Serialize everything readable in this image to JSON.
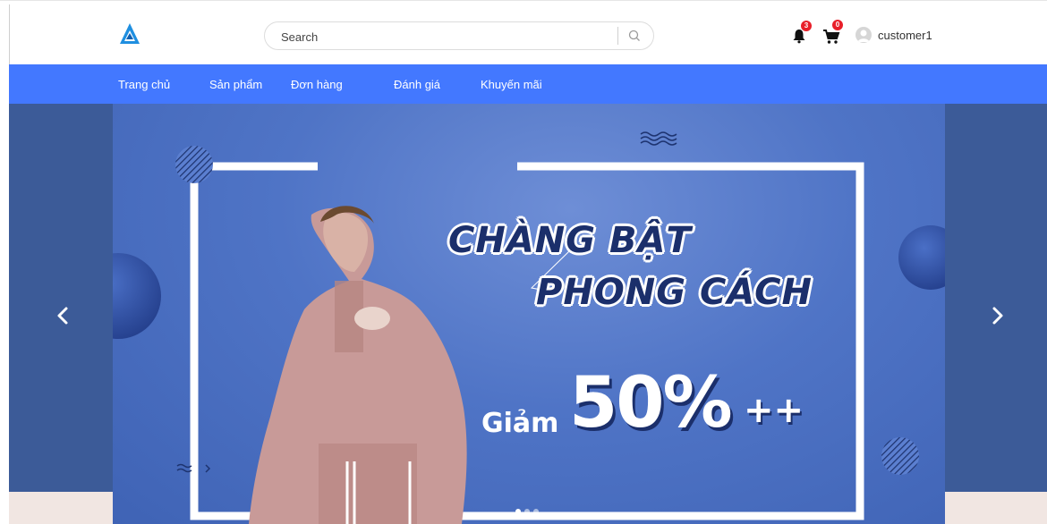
{
  "header": {
    "logo_icon": "triangle-logo-icon",
    "search": {
      "placeholder": "Search",
      "value": "",
      "icon": "search-icon"
    },
    "notifications": {
      "icon": "bell-icon",
      "count": "3"
    },
    "cart": {
      "icon": "cart-icon",
      "count": "0"
    },
    "user": {
      "avatar_icon": "user-avatar-icon",
      "name": "customer1"
    }
  },
  "nav": {
    "items": [
      {
        "label": "Trang chủ"
      },
      {
        "label": "Sản phẩm"
      },
      {
        "label": "Đơn hàng"
      },
      {
        "label": "Đánh giá"
      },
      {
        "label": "Khuyến mãi"
      }
    ]
  },
  "banner": {
    "headline_line1": "CHÀNG BẬT",
    "headline_line2": "PHONG CÁCH",
    "promo_label": "Giảm",
    "promo_value": "50%",
    "promo_suffix": "++",
    "prev_icon": "chevron-left-icon",
    "next_icon": "chevron-right-icon",
    "slide_count": 3,
    "active_slide": 1
  },
  "colors": {
    "nav_bg": "#4378ff",
    "banner_blue": "#4f74c6",
    "banner_side": "#3c5b98",
    "badge": "#e8202a",
    "headline_text": "#1b2f6b"
  }
}
